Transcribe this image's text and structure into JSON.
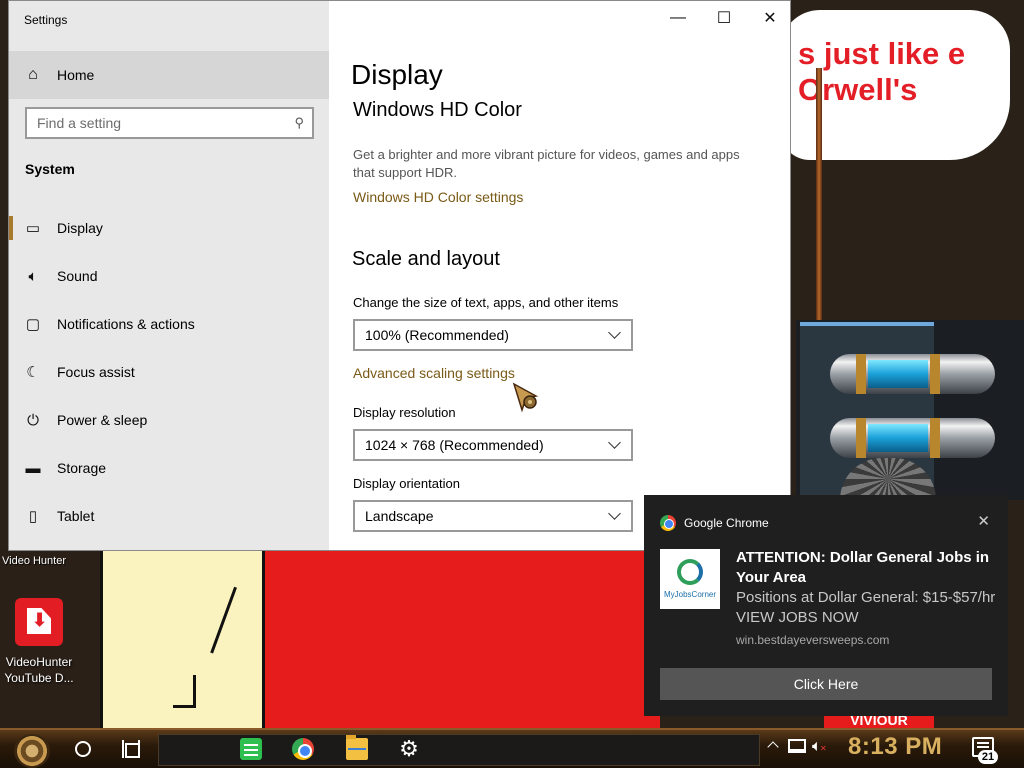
{
  "window": {
    "title": "Settings"
  },
  "sidebar": {
    "home": "Home",
    "search_placeholder": "Find a setting",
    "section": "System",
    "items": [
      {
        "label": "Display",
        "icon": "monitor-icon"
      },
      {
        "label": "Sound",
        "icon": "speaker-icon"
      },
      {
        "label": "Notifications & actions",
        "icon": "notification-icon"
      },
      {
        "label": "Focus assist",
        "icon": "moon-icon"
      },
      {
        "label": "Power & sleep",
        "icon": "power-icon"
      },
      {
        "label": "Storage",
        "icon": "storage-icon"
      },
      {
        "label": "Tablet",
        "icon": "tablet-icon"
      }
    ],
    "active": "Display"
  },
  "main": {
    "title": "Display",
    "hdr": {
      "heading": "Windows HD Color",
      "description": "Get a brighter and more vibrant picture for videos, games and apps that support HDR.",
      "link": "Windows HD Color settings"
    },
    "scale": {
      "heading": "Scale and layout",
      "size_label": "Change the size of text, apps, and other items",
      "size_value": "100% (Recommended)",
      "advanced_link": "Advanced scaling settings",
      "resolution_label": "Display resolution",
      "resolution_value": "1024 × 768 (Recommended)",
      "orientation_label": "Display orientation",
      "orientation_value": "Landscape"
    }
  },
  "notification": {
    "app": "Google Chrome",
    "logo_text": "MyJobsCorner",
    "title": "ATTENTION: Dollar General Jobs in Your Area",
    "body": "Positions at Dollar General: $15-$57/hr VIEW JOBS NOW",
    "domain": "win.bestdayeversweeps.com",
    "action": "Click Here"
  },
  "desktop": {
    "partial_label": "Video Hunter",
    "icon_label": "VideoHunter YouTube D...",
    "bubble_text": "s just like e Orwell's",
    "bottom_text": "VIVIOUR"
  },
  "taskbar": {
    "clock": "8:13 PM",
    "notification_count": "21"
  },
  "colors": {
    "accent": "#a87b2e",
    "link": "#7a5a16",
    "toast_bg": "#1f1f1f",
    "sidebar_bg": "#e8e8e8"
  }
}
